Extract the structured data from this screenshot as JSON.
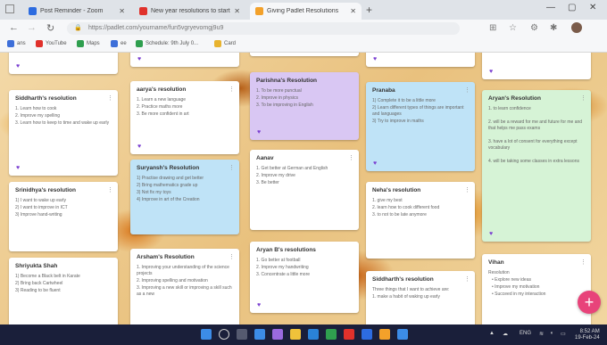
{
  "browser": {
    "tabs": [
      {
        "label": "Post Reminder - Zoom",
        "color": "#2d6ce0"
      },
      {
        "label": "New year resolutions to start",
        "color": "#e0312b"
      },
      {
        "label": "Giving Padlet Resolutions",
        "color": "#f3a12a"
      }
    ],
    "url": "https://padlet.com/yourname/fun5vgryevomgj9u9",
    "bookmarks": [
      {
        "label": "ans",
        "color": "#3d6fd9"
      },
      {
        "label": "YouTube",
        "color": "#e0312b"
      },
      {
        "label": "Maps",
        "color": "#2f9f4f"
      },
      {
        "label": "ee",
        "color": "#3d6fd9"
      },
      {
        "label": "Schedule: 9th July 0...",
        "color": "#2f9f4f"
      },
      {
        "label": "Card",
        "color": "#e8b32f"
      }
    ]
  },
  "board": {
    "cards": [
      {
        "title": "",
        "body": [],
        "color": "#ffffff"
      },
      {
        "title": "",
        "body": [],
        "color": "#ffffff"
      },
      {
        "title": "",
        "body": [],
        "color": "#ffffff"
      },
      {
        "title": "",
        "body": [],
        "color": "#ffffff"
      },
      {
        "title": "",
        "body": [],
        "color": "#ffffff"
      },
      {
        "title": "Siddharth's resolution",
        "body": [
          "1. Learn how to cook",
          "2. Improve my spelling",
          "3. Learn how to keep to time and wake up early"
        ],
        "color": "#ffffff"
      },
      {
        "title": "Srinidhya's resolution",
        "body": [
          "1) I want to wake up early",
          "2) I want to improve in ICT",
          "3) Improve hand-writing"
        ],
        "color": "#ffffff"
      },
      {
        "title": "Shriyukta Shah",
        "body": [
          "1) Become a Black belt in Karate",
          "2) Bring back Cartwheel",
          "3) Reading to be fluent"
        ],
        "color": "#ffffff"
      },
      {
        "title": "aarya's resolution",
        "body": [
          "1. Learn a new language",
          "2. Practice maths more",
          "3. Be more confident in art"
        ],
        "color": "#ffffff"
      },
      {
        "title": "Suryansh's Resolution",
        "body": [
          "1) Practise drawing and get better",
          "2) Bring mathematics grade up",
          "3) Not fix my toys",
          "4) Improve in art of the Creation"
        ],
        "color": "#bfe3f7"
      },
      {
        "title": "Arsham's Resolution",
        "body": [
          "1. Improving your understanding of the science projects",
          "2. Improving spelling and motivation",
          "3. Improving a new skill or improving a skill such as a new"
        ],
        "color": "#ffffff"
      },
      {
        "title": "Parishna's Resolution",
        "body": [
          "1. To be more punctual",
          "2. Improve in physics",
          "3. To be improving in English"
        ],
        "color": "#d9c7f3"
      },
      {
        "title": "Aanav",
        "body": [
          "1. Get better at German and English",
          "2. Improve my drive",
          "3. Be better"
        ],
        "color": "#ffffff"
      },
      {
        "title": "Aryan B's resolutions",
        "body": [
          "1. Go better at football",
          "2. Improve my handwriting",
          "3. Concentrate a little more"
        ],
        "color": "#ffffff"
      },
      {
        "title": "Pranaba",
        "body": [
          "1) Complete it to be a little more",
          "2) Learn different types of things are important and languages",
          "3) Try to improve in maths"
        ],
        "color": "#bfe3f7"
      },
      {
        "title": "Neha's resolution",
        "body": [
          "1. give my best",
          "2. learn how to cook different food",
          "3. to not to be late anymore"
        ],
        "color": "#ffffff"
      },
      {
        "title": "Siddharth's resolution",
        "body": [
          "Three things that I want to achieve are:",
          "1. make a habit of waking up early"
        ],
        "color": "#ffffff"
      },
      {
        "title": "Aryan's Resolution",
        "body": [
          "1. to learn confidence",
          "2. will be a reward for me and future for me and that helps me pass exams",
          "3. have a lot of consent for everything except vocabulary",
          "4. will be taking some classes in extra lessons"
        ],
        "color": "#d6f3d6"
      },
      {
        "title": "Vihan",
        "body": [
          "Resolution",
          "• Explore new ideas",
          "• Improve my motivation",
          "• Succeed in my interaction"
        ],
        "color": "#ffffff"
      }
    ]
  },
  "taskbar": {
    "time": "8:52 AM",
    "date": "19-Feb-24",
    "lang": "ENG"
  }
}
